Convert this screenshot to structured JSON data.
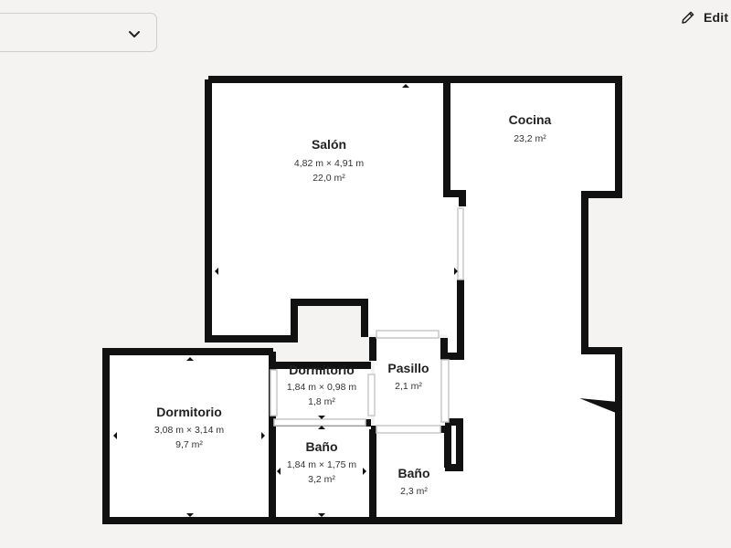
{
  "toolbar": {
    "floor_select": {
      "value": "",
      "icon": "chevron-down-icon"
    },
    "edit": {
      "label": "Edit",
      "icon": "pencil-icon"
    }
  },
  "rooms": {
    "salon": {
      "name": "Salón",
      "dimensions": "4,82 m × 4,91 m",
      "area": "22,0 m²"
    },
    "cocina": {
      "name": "Cocina",
      "area": "23,2 m²"
    },
    "pasillo": {
      "name": "Pasillo",
      "area": "2,1 m²"
    },
    "dormitorio_pequeno": {
      "name": "Dormitorio",
      "dimensions": "1,84 m × 0,98 m",
      "area": "1,8 m²"
    },
    "dormitorio": {
      "name": "Dormitorio",
      "dimensions": "3,08 m × 3,14 m",
      "area": "9,7 m²"
    },
    "bano_1": {
      "name": "Baño",
      "dimensions": "1,84 m × 1,75 m",
      "area": "3,2 m²"
    },
    "bano_2": {
      "name": "Baño",
      "area": "2,3 m²"
    }
  },
  "colors": {
    "wall": "#111111",
    "floor": "#ffffff",
    "background": "#f4f3f1"
  }
}
